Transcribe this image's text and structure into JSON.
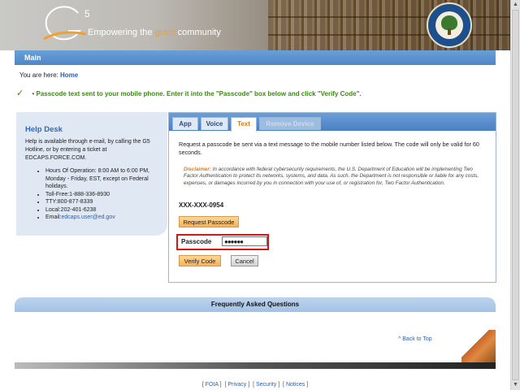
{
  "header": {
    "logo_letter": "G",
    "logo_superscript": "5",
    "tagline_prefix": "Empowering the ",
    "tagline_highlight": "grant",
    "tagline_suffix": " community"
  },
  "main_bar": {
    "title": "Main"
  },
  "breadcrumb": {
    "prefix": "You are here: ",
    "home": "Home"
  },
  "success_message": "Passcode text sent to your mobile phone. Enter it into the \"Passcode\" box below and click \"Verify Code\".",
  "help_desk": {
    "title": "Help Desk",
    "intro": "Help is available through e-mail, by calling the G5 Hotline, or by entering a ticket at EDCAPS.FORCE.COM.",
    "items": [
      "Hours Of Operation: 8:00 AM to 6:00 PM, Monday - Friday, EST, except on Federal holidays.",
      "Toll-Free:1-888-336-8930",
      "TTY:800-877-8339",
      "Local:202-401-6238"
    ],
    "email_label": "Email:",
    "email": "edcaps.user@ed.gov"
  },
  "tabs": [
    {
      "label": "App",
      "state": "normal"
    },
    {
      "label": "Voice",
      "state": "normal"
    },
    {
      "label": "Text",
      "state": "active"
    },
    {
      "label": "Remove Device",
      "state": "disabled"
    }
  ],
  "panel": {
    "description": "Request a passcode be sent via a text message to the mobile number listed below. The code will only be valid for 60 seconds.",
    "disclaimer_label": "Disclaimer:",
    "disclaimer_text": " In accordance with federal cybersecurity requirements, the U.S. Department of Education will be implementing Two Factor Authentication to protect its networks, systems, and data. As such, the Department is not responsible or liable for any costs, expenses, or damages incurred by you in connection with your use of, or registration for, Two Factor Authentication.",
    "phone": "XXX-XXX-0954",
    "request_button": "Request Passcode",
    "passcode_label": "Passcode",
    "passcode_value": "●●●●●●",
    "verify_button": "Verify Code",
    "cancel_button": "Cancel"
  },
  "faq": {
    "title": "Frequently Asked Questions",
    "back_to_top": "^ Back to Top"
  },
  "footer": {
    "links": [
      "FOIA",
      "Privacy",
      "Security",
      "Notices"
    ]
  },
  "colors": {
    "accent": "#4f86c6",
    "active_tab": "#e07a10",
    "success": "#3a8a10",
    "highlight_border": "#d01818"
  }
}
